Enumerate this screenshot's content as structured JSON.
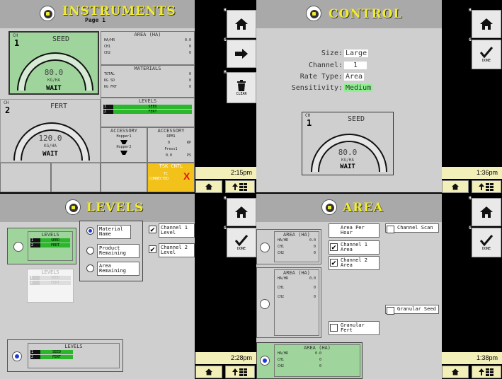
{
  "instruments": {
    "title": "INSTRUMENTS",
    "page": "Page 1",
    "seed": {
      "ch_label": "CH",
      "ch": "1",
      "name": "SEED",
      "value": "80.0",
      "unit": "KG/HA",
      "status": "WAIT"
    },
    "fert": {
      "ch_label": "CH",
      "ch": "2",
      "name": "FERT",
      "value": "120.0",
      "unit": "KG/HA",
      "status": "WAIT"
    },
    "area": {
      "title": "AREA (HA)",
      "rows": [
        [
          "HA/HR",
          "0.0"
        ],
        [
          "CH1",
          "0"
        ],
        [
          "CH2",
          "0"
        ]
      ]
    },
    "materials": {
      "title": "MATERIALS",
      "rows": [
        [
          "TOTAL",
          "0"
        ],
        [
          "KG SD",
          "0"
        ],
        [
          "KG FRT",
          "0"
        ]
      ]
    },
    "levels": {
      "title": "LEVELS",
      "rows": [
        [
          "1",
          "SEED"
        ],
        [
          "2",
          "FERT"
        ]
      ]
    },
    "accessory1": {
      "title": "ACCESSORY",
      "label": "Hopper1",
      "label2": "Hopper2"
    },
    "accessory2": {
      "title": "ACCESSORY",
      "label": "RPM1",
      "val": "0",
      "unit": "RP",
      "label2": "Press1",
      "val2": "0.0",
      "unit2": "PS"
    },
    "tsk": {
      "title": "TSK CNTL",
      "line1": "TC",
      "line2": "CONNECTED",
      "mark": "X"
    },
    "buttons": {
      "home": "⌂",
      "next": "➡",
      "clear": "CLEAR",
      "corner_h": "H",
      "corner_g": "G",
      "corner_m": "M"
    },
    "time": "2:15pm"
  },
  "control": {
    "title": "CONTROL",
    "size_label": "Size:",
    "size": "Large",
    "channel_label": "Channel:",
    "channel": "1",
    "rate_label": "Rate Type:",
    "rate": "Area",
    "sens_label": "Sensitivity:",
    "sens": "Medium",
    "gauge": {
      "ch_label": "CH",
      "ch": "1",
      "name": "SEED",
      "value": "80.0",
      "unit": "KG/HA",
      "status": "WAIT"
    },
    "done": "DONE",
    "time": "1:36pm"
  },
  "levels_screen": {
    "title": "LEVELS",
    "box_title": "LEVELS",
    "rows": [
      [
        "1",
        "SEED"
      ],
      [
        "2",
        "FERT"
      ]
    ],
    "opt_material": "Material Name",
    "opt_product": "Product Remaining",
    "opt_area": "Area Remaining",
    "ch1": "Channel 1 Level",
    "ch2": "Channel 2 Level",
    "done": "DONE",
    "time": "2:28pm"
  },
  "area_screen": {
    "title": "AREA",
    "box_title": "AREA (HA)",
    "rows": [
      [
        "HA/HR",
        "0.0"
      ],
      [
        "CH1",
        "0"
      ],
      [
        "CH2",
        "0"
      ]
    ],
    "area_hr": "Area Per Hour",
    "ch1": "Channel 1 Area",
    "ch2": "Channel 2 Area",
    "ch_scan": "Channel Scan",
    "gran_seed": "Granular Seed",
    "gran_fert": "Granular Fert",
    "done": "DONE",
    "time": "1:38pm"
  },
  "colors": {
    "accent": "#f1ec2f",
    "green": "#9fd59c",
    "header": "#a9a9a9"
  }
}
